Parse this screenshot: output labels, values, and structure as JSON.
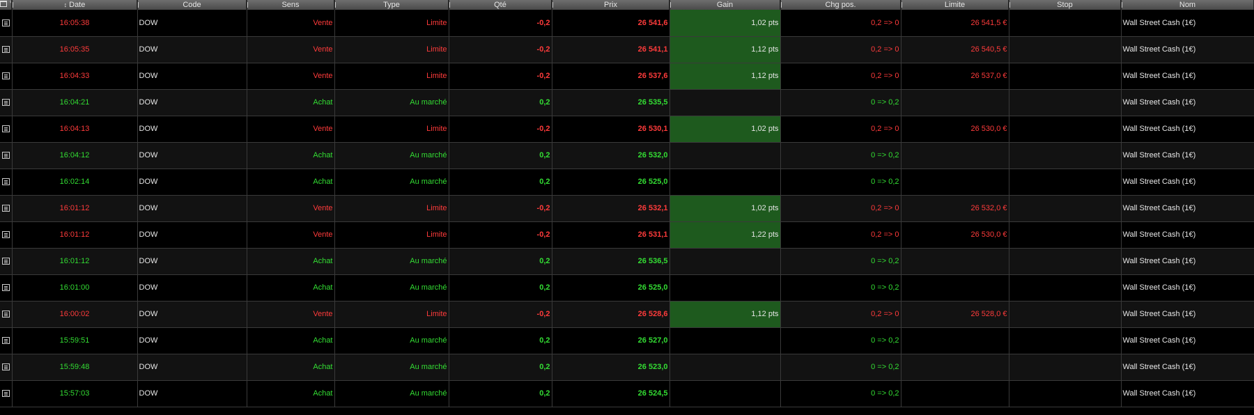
{
  "header": {
    "date": "Date",
    "code": "Code",
    "sens": "Sens",
    "type": "Type",
    "qte": "Qté",
    "prix": "Prix",
    "gain": "Gain",
    "chg": "Chg pos.",
    "limite": "Limite",
    "stop": "Stop",
    "nom": "Nom"
  },
  "icons": {
    "header_doc": "document-icon",
    "header_tool": "wrench-icon",
    "sort": "pin-icon",
    "row": "order-detail-icon"
  },
  "colors": {
    "sell": "#ff3b3b",
    "buy": "#33dd33",
    "gain_bg": "#1e5a1e"
  },
  "rows": [
    {
      "date": "16:05:38",
      "code": "DOW",
      "sens": "Vente",
      "type": "Limite",
      "qte": "-0,2",
      "prix": "26 541,6",
      "gain": "1,02 pts",
      "chg": "0,2 => 0",
      "limite": "26 541,5 €",
      "stop": "",
      "nom": "Wall Street Cash (1€)"
    },
    {
      "date": "16:05:35",
      "code": "DOW",
      "sens": "Vente",
      "type": "Limite",
      "qte": "-0,2",
      "prix": "26 541,1",
      "gain": "1,12 pts",
      "chg": "0,2 => 0",
      "limite": "26 540,5 €",
      "stop": "",
      "nom": "Wall Street Cash (1€)"
    },
    {
      "date": "16:04:33",
      "code": "DOW",
      "sens": "Vente",
      "type": "Limite",
      "qte": "-0,2",
      "prix": "26 537,6",
      "gain": "1,12 pts",
      "chg": "0,2 => 0",
      "limite": "26 537,0 €",
      "stop": "",
      "nom": "Wall Street Cash (1€)"
    },
    {
      "date": "16:04:21",
      "code": "DOW",
      "sens": "Achat",
      "type": "Au marché",
      "qte": "0,2",
      "prix": "26 535,5",
      "gain": "",
      "chg": "0 => 0,2",
      "limite": "",
      "stop": "",
      "nom": "Wall Street Cash (1€)"
    },
    {
      "date": "16:04:13",
      "code": "DOW",
      "sens": "Vente",
      "type": "Limite",
      "qte": "-0,2",
      "prix": "26 530,1",
      "gain": "1,02 pts",
      "chg": "0,2 => 0",
      "limite": "26 530,0 €",
      "stop": "",
      "nom": "Wall Street Cash (1€)"
    },
    {
      "date": "16:04:12",
      "code": "DOW",
      "sens": "Achat",
      "type": "Au marché",
      "qte": "0,2",
      "prix": "26 532,0",
      "gain": "",
      "chg": "0 => 0,2",
      "limite": "",
      "stop": "",
      "nom": "Wall Street Cash (1€)"
    },
    {
      "date": "16:02:14",
      "code": "DOW",
      "sens": "Achat",
      "type": "Au marché",
      "qte": "0,2",
      "prix": "26 525,0",
      "gain": "",
      "chg": "0 => 0,2",
      "limite": "",
      "stop": "",
      "nom": "Wall Street Cash (1€)"
    },
    {
      "date": "16:01:12",
      "code": "DOW",
      "sens": "Vente",
      "type": "Limite",
      "qte": "-0,2",
      "prix": "26 532,1",
      "gain": "1,02 pts",
      "chg": "0,2 => 0",
      "limite": "26 532,0 €",
      "stop": "",
      "nom": "Wall Street Cash (1€)"
    },
    {
      "date": "16:01:12",
      "code": "DOW",
      "sens": "Vente",
      "type": "Limite",
      "qte": "-0,2",
      "prix": "26 531,1",
      "gain": "1,22 pts",
      "chg": "0,2 => 0",
      "limite": "26 530,0 €",
      "stop": "",
      "nom": "Wall Street Cash (1€)"
    },
    {
      "date": "16:01:12",
      "code": "DOW",
      "sens": "Achat",
      "type": "Au marché",
      "qte": "0,2",
      "prix": "26 536,5",
      "gain": "",
      "chg": "0 => 0,2",
      "limite": "",
      "stop": "",
      "nom": "Wall Street Cash (1€)"
    },
    {
      "date": "16:01:00",
      "code": "DOW",
      "sens": "Achat",
      "type": "Au marché",
      "qte": "0,2",
      "prix": "26 525,0",
      "gain": "",
      "chg": "0 => 0,2",
      "limite": "",
      "stop": "",
      "nom": "Wall Street Cash (1€)"
    },
    {
      "date": "16:00:02",
      "code": "DOW",
      "sens": "Vente",
      "type": "Limite",
      "qte": "-0,2",
      "prix": "26 528,6",
      "gain": "1,12 pts",
      "chg": "0,2 => 0",
      "limite": "26 528,0 €",
      "stop": "",
      "nom": "Wall Street Cash (1€)"
    },
    {
      "date": "15:59:51",
      "code": "DOW",
      "sens": "Achat",
      "type": "Au marché",
      "qte": "0,2",
      "prix": "26 527,0",
      "gain": "",
      "chg": "0 => 0,2",
      "limite": "",
      "stop": "",
      "nom": "Wall Street Cash (1€)"
    },
    {
      "date": "15:59:48",
      "code": "DOW",
      "sens": "Achat",
      "type": "Au marché",
      "qte": "0,2",
      "prix": "26 523,0",
      "gain": "",
      "chg": "0 => 0,2",
      "limite": "",
      "stop": "",
      "nom": "Wall Street Cash (1€)"
    },
    {
      "date": "15:57:03",
      "code": "DOW",
      "sens": "Achat",
      "type": "Au marché",
      "qte": "0,2",
      "prix": "26 524,5",
      "gain": "",
      "chg": "0 => 0,2",
      "limite": "",
      "stop": "",
      "nom": "Wall Street Cash (1€)"
    }
  ]
}
